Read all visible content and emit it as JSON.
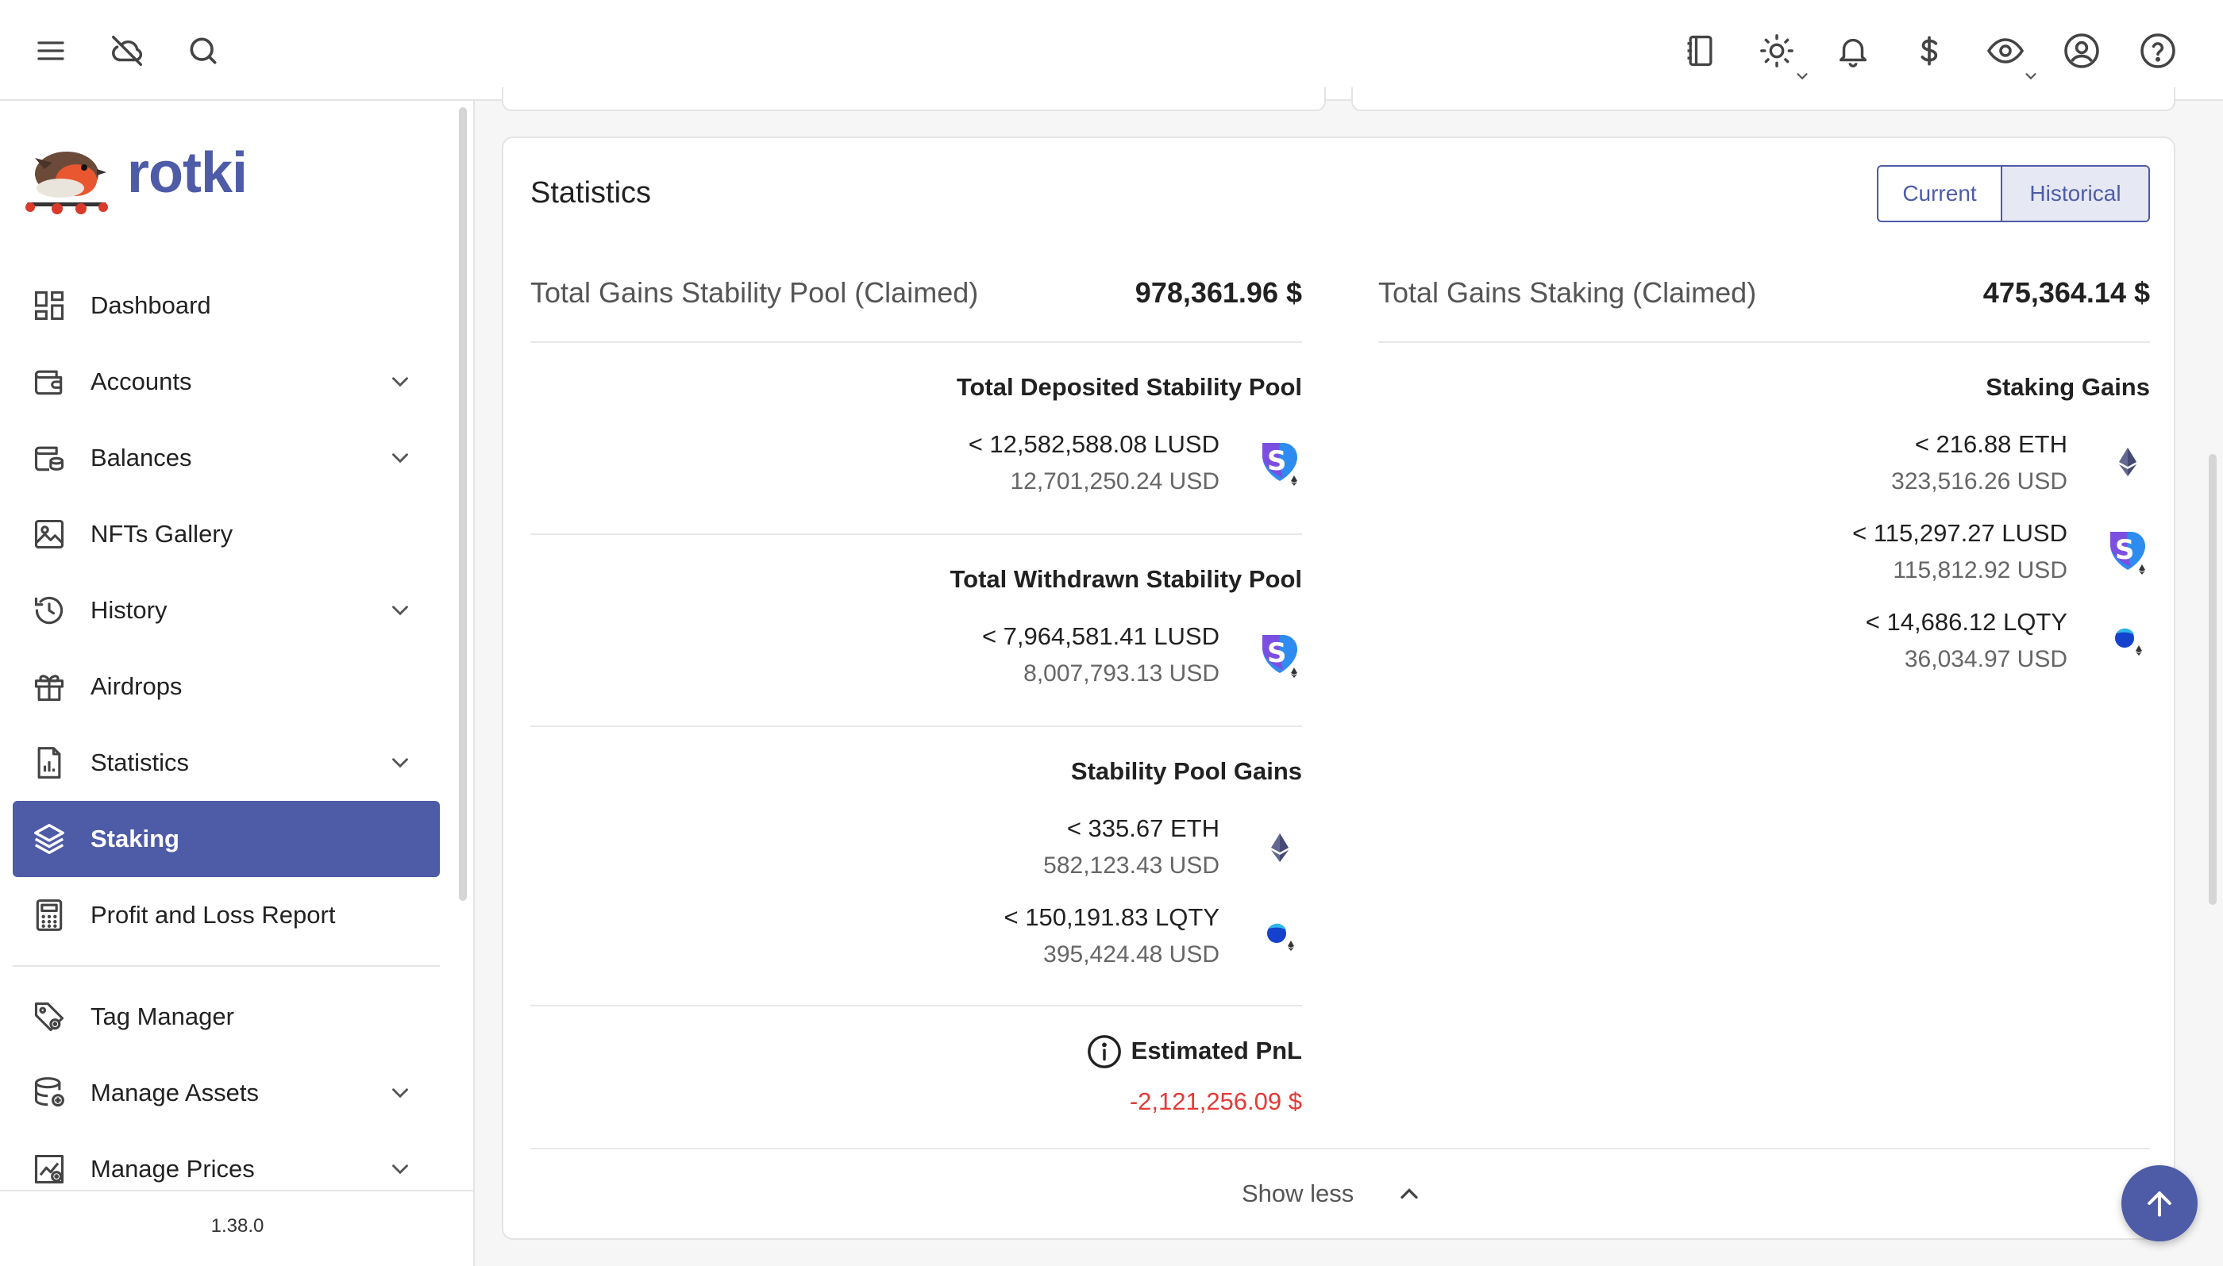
{
  "app": {
    "name": "rotki",
    "version": "1.38.0"
  },
  "topbar": {
    "left_icons": [
      "menu-icon",
      "cloud-off-icon",
      "search-icon"
    ],
    "right_icons": [
      "notebook-icon",
      "theme-sun-icon",
      "bell-icon",
      "currency-dollar-icon",
      "eye-icon",
      "account-circle-icon",
      "help-icon"
    ]
  },
  "sidebar": {
    "items": [
      {
        "label": "Dashboard",
        "icon": "dashboard-icon",
        "expandable": false,
        "active": false
      },
      {
        "label": "Accounts",
        "icon": "wallet-icon",
        "expandable": true,
        "active": false
      },
      {
        "label": "Balances",
        "icon": "balances-icon",
        "expandable": true,
        "active": false
      },
      {
        "label": "NFTs Gallery",
        "icon": "image-icon",
        "expandable": false,
        "active": false
      },
      {
        "label": "History",
        "icon": "history-icon",
        "expandable": true,
        "active": false
      },
      {
        "label": "Airdrops",
        "icon": "gift-icon",
        "expandable": false,
        "active": false
      },
      {
        "label": "Statistics",
        "icon": "chart-icon",
        "expandable": true,
        "active": false
      },
      {
        "label": "Staking",
        "icon": "stack-icon",
        "expandable": false,
        "active": true
      },
      {
        "label": "Profit and Loss Report",
        "icon": "calculator-icon",
        "expandable": false,
        "active": false
      }
    ],
    "secondary_items": [
      {
        "label": "Tag Manager",
        "icon": "tag-icon",
        "expandable": false
      },
      {
        "label": "Manage Assets",
        "icon": "database-icon",
        "expandable": true
      },
      {
        "label": "Manage Prices",
        "icon": "price-chart-icon",
        "expandable": true
      }
    ]
  },
  "statistics": {
    "title": "Statistics",
    "toggle": {
      "current": "Current",
      "historical": "Historical",
      "selected": "Historical"
    },
    "stability_pool": {
      "total_gains_label": "Total Gains Stability Pool (Claimed)",
      "total_gains_value": "978,361.96 $",
      "deposited": {
        "title": "Total Deposited Stability Pool",
        "amount": "< 12,582,588.08 LUSD",
        "usd": "12,701,250.24 USD",
        "icon": "lusd-icon"
      },
      "withdrawn": {
        "title": "Total Withdrawn Stability Pool",
        "amount": "< 7,964,581.41 LUSD",
        "usd": "8,007,793.13 USD",
        "icon": "lusd-icon"
      },
      "gains": {
        "title": "Stability Pool Gains",
        "items": [
          {
            "amount": "< 335.67 ETH",
            "usd": "582,123.43 USD",
            "icon": "eth-icon"
          },
          {
            "amount": "< 150,191.83 LQTY",
            "usd": "395,424.48 USD",
            "icon": "lqty-icon"
          }
        ]
      },
      "pnl": {
        "label": "Estimated PnL",
        "value": "-2,121,256.09 $",
        "icon": "info-icon"
      }
    },
    "staking": {
      "total_gains_label": "Total Gains Staking (Claimed)",
      "total_gains_value": "475,364.14 $",
      "gains": {
        "title": "Staking Gains",
        "items": [
          {
            "amount": "< 216.88 ETH",
            "usd": "323,516.26 USD",
            "icon": "eth-icon"
          },
          {
            "amount": "< 115,297.27 LUSD",
            "usd": "115,812.92 USD",
            "icon": "lusd-icon"
          },
          {
            "amount": "< 14,686.12 LQTY",
            "usd": "36,034.97 USD",
            "icon": "lqty-icon"
          }
        ]
      }
    },
    "show_less": "Show less"
  },
  "colors": {
    "primary": "#4e5ba6",
    "negative": "#e53935",
    "lusd": "#2e8bf0",
    "lqty": "#1542cd"
  }
}
